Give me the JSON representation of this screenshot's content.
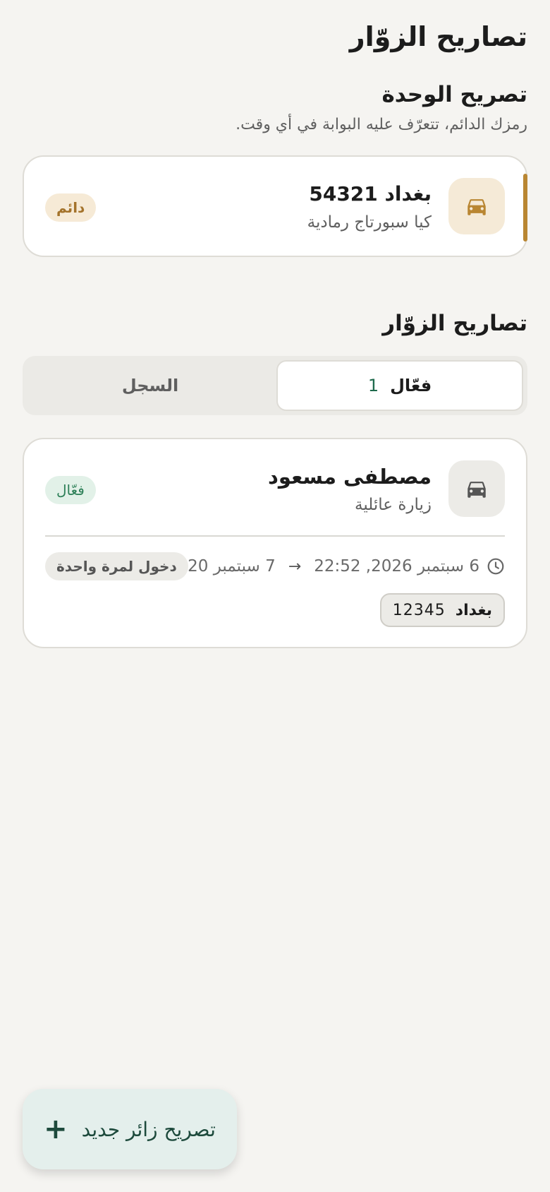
{
  "page_title": "تصاريح الزوّار",
  "unit_permit": {
    "title": "تصريح الوحدة",
    "subtitle": "رمزك الدائم، تتعرّف عليه البوابة في أي وقت.",
    "plate": "بغداد 54321",
    "car_model": "كيا سبورتاج رمادية",
    "status": "دائم",
    "icon": "car-icon",
    "accent_color": "#b98632"
  },
  "visitor_permits": {
    "title": "تصاريح الزوّار",
    "tabs": [
      {
        "label": "فعّال",
        "count": "1",
        "selected": true
      },
      {
        "label": "السجل",
        "selected": false
      }
    ],
    "items": [
      {
        "name": "مصطفى مسعود",
        "visit_type": "زيارة عائلية",
        "status": "فعّال",
        "time_start": "6 سبتمبر 2026, 22:52",
        "arrow": "→",
        "time_end": "7 سبتمبر 20...",
        "entry_type": "دخول لمرة واحدة",
        "plate_city": "بغداد",
        "plate_number": "12345",
        "icon": "car-icon",
        "status_color": "#2c7f57"
      }
    ]
  },
  "fab": {
    "label": "تصريح زائر جديد",
    "icon": "plus-icon"
  }
}
